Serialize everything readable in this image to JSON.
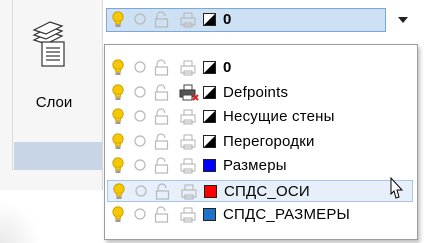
{
  "ribbon": {
    "layers_label": "Слои"
  },
  "combo": {
    "current_layer": "0",
    "current_color": "#000000"
  },
  "layers": [
    {
      "name": "0",
      "color": "#000000",
      "bold": true,
      "plot_disabled": false,
      "selected": false
    },
    {
      "name": "Defpoints",
      "color": "#000000",
      "bold": false,
      "plot_disabled": true,
      "selected": false
    },
    {
      "name": "Несущие стены",
      "color": "#000000",
      "bold": false,
      "plot_disabled": false,
      "selected": false
    },
    {
      "name": "Перегородки",
      "color": "#000000",
      "bold": false,
      "plot_disabled": false,
      "selected": false
    },
    {
      "name": "Размеры",
      "color": "#0000ff",
      "bold": false,
      "plot_disabled": false,
      "selected": false
    },
    {
      "name": "СПДС_ОСИ",
      "color": "#ff0000",
      "bold": false,
      "plot_disabled": false,
      "selected": true
    },
    {
      "name": "СПДС_РАЗМЕРЫ",
      "color": "#1e73c8",
      "bold": false,
      "plot_disabled": false,
      "selected": false
    }
  ],
  "icons": {
    "on": "lightbulb-icon",
    "freeze": "sun-icon",
    "lock": "lock-icon",
    "plot": "printer-icon",
    "dropdown": "chevron-down-icon",
    "layers": "layers-stack-icon",
    "cursor": "mouse-pointer-icon"
  }
}
